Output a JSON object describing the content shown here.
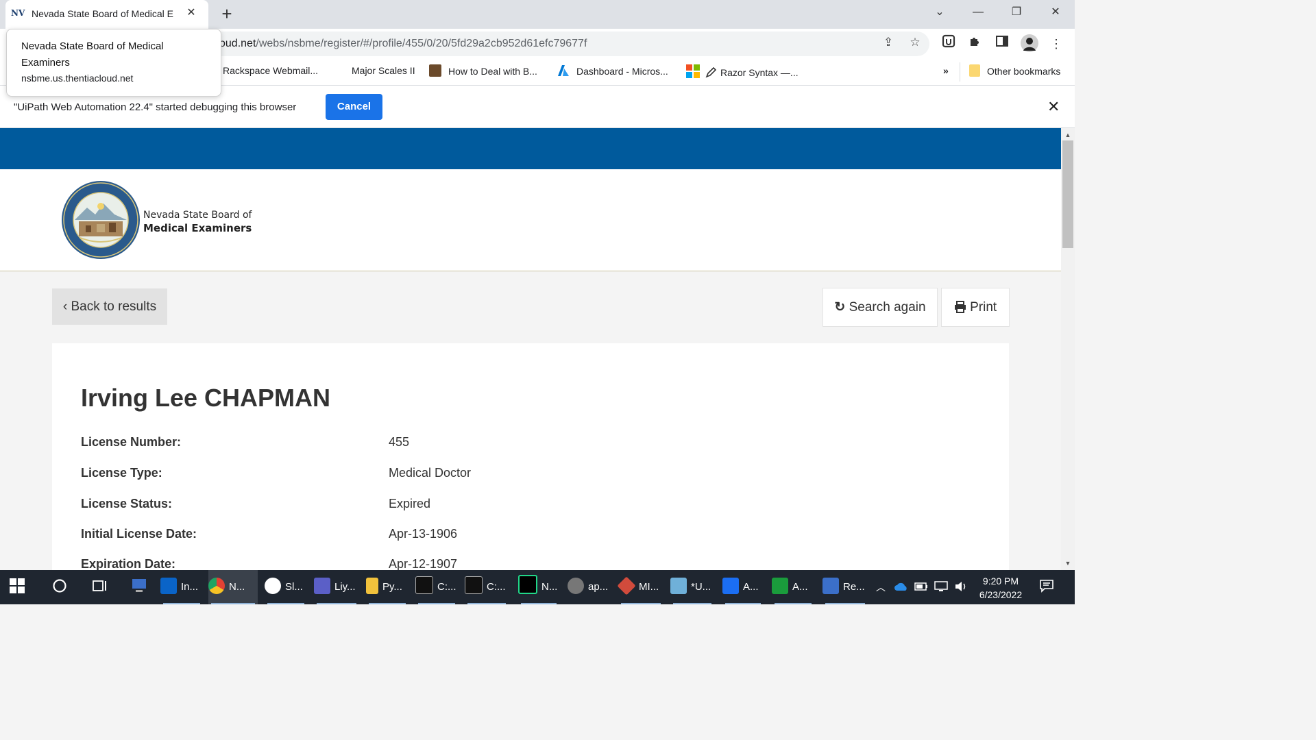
{
  "browser": {
    "tab": {
      "favicon": "NV",
      "title": "Nevada State Board of Medical E",
      "close": "✕"
    },
    "new_tab": "+",
    "window": {
      "dropdown": "⌄",
      "minimize": "—",
      "restore": "❐",
      "close": "✕"
    },
    "url_host_tail": "oud.net",
    "url_path": "/webs/nsbme/register/#/profile/455/0/20/5fd29a2cb952d61efc79677f",
    "bookmarks": [
      {
        "label": "Rackspace Webmail..."
      },
      {
        "label": "Major Scales II"
      },
      {
        "label": "How to Deal with B..."
      },
      {
        "label": "Dashboard - Micros..."
      },
      {
        "label": "Razor Syntax —..."
      }
    ],
    "bookmarks_more": "»",
    "other_bookmarks": "Other bookmarks",
    "tooltip": {
      "title": "Nevada State Board of Medical Examiners",
      "url": "nsbme.us.thentiacloud.net"
    },
    "infobar": {
      "message": "\"UiPath Web Automation 22.4\" started debugging this browser",
      "cancel": "Cancel",
      "close": "✕"
    }
  },
  "site": {
    "brand_line1": "Nevada State Board of",
    "brand_line2": "Medical Examiners",
    "back_button": "Back to results",
    "search_again": "Search again",
    "print": "Print",
    "profile": {
      "name": "Irving Lee CHAPMAN",
      "fields": [
        {
          "label": "License Number:",
          "value": "455"
        },
        {
          "label": "License Type:",
          "value": "Medical Doctor"
        },
        {
          "label": "License Status:",
          "value": "Expired"
        },
        {
          "label": "Initial License Date:",
          "value": "Apr-13-1906"
        },
        {
          "label": "Expiration Date:",
          "value": "Apr-12-1907"
        }
      ]
    }
  },
  "taskbar": {
    "apps": [
      {
        "label": "In...",
        "icon": "outlook-icon",
        "color": "#0a64c8"
      },
      {
        "label": "N...",
        "icon": "chrome-icon",
        "color": "#e44134"
      },
      {
        "label": "Sl...",
        "icon": "slack-icon",
        "color": "#e01e5a"
      },
      {
        "label": "Liy...",
        "icon": "teams-icon",
        "color": "#5b5fc7"
      },
      {
        "label": "Py...",
        "icon": "folder-icon",
        "color": "#f2c23c"
      },
      {
        "label": "C:...",
        "icon": "terminal-icon",
        "color": "#111111"
      },
      {
        "label": "C:...",
        "icon": "terminal-icon",
        "color": "#111111"
      },
      {
        "label": "N...",
        "icon": "pycharm-icon",
        "color": "#21d789"
      },
      {
        "label": "ap...",
        "icon": "gear-icon",
        "color": "#777777"
      },
      {
        "label": "MI...",
        "icon": "diamond-icon",
        "color": "#d14b3c"
      },
      {
        "label": "*U...",
        "icon": "notepad-icon",
        "color": "#6fb0d9"
      },
      {
        "label": "A...",
        "icon": "sharepoint-icon",
        "color": "#1b6ef3"
      },
      {
        "label": "A...",
        "icon": "player-icon",
        "color": "#1a9c3c"
      },
      {
        "label": "Re...",
        "icon": "remote-desktop-icon",
        "color": "#3b6fc9"
      }
    ],
    "time": "9:20 PM",
    "date": "6/23/2022"
  }
}
